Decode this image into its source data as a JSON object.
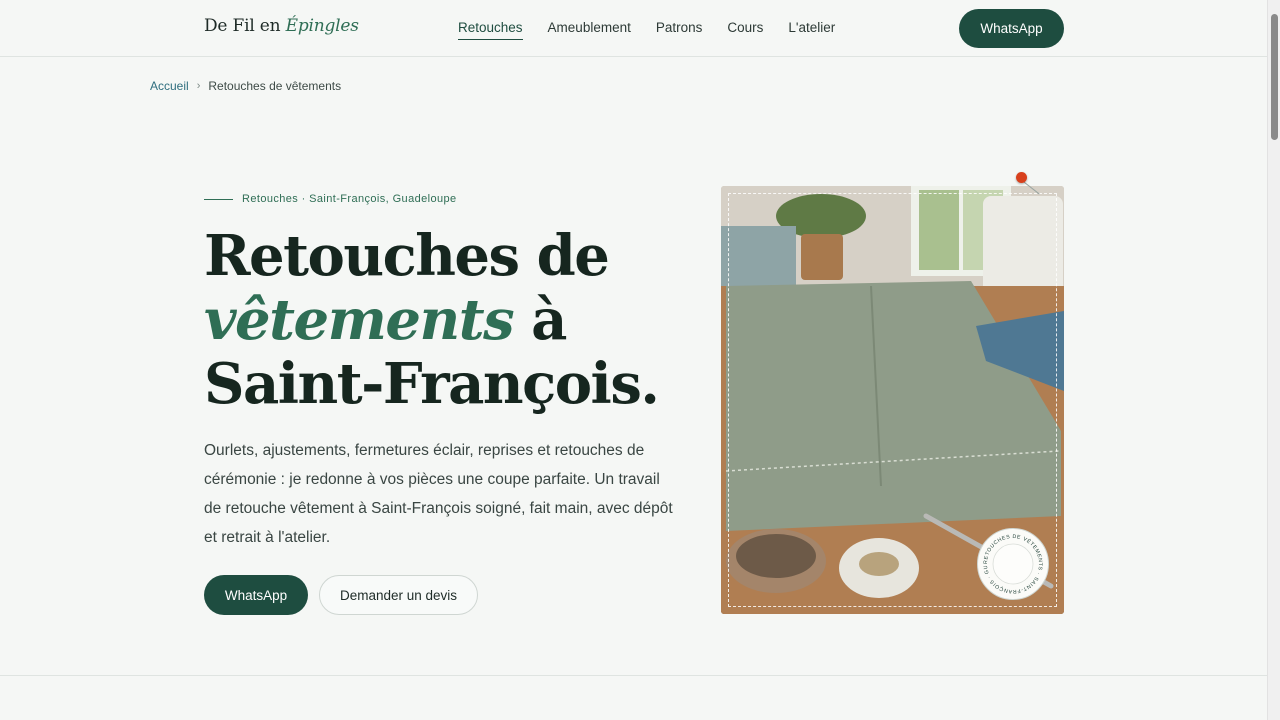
{
  "header": {
    "logo_main": "De Fil en",
    "logo_accent": "Épingles",
    "nav": [
      {
        "label": "Retouches"
      },
      {
        "label": "Ameublement"
      },
      {
        "label": "Patrons"
      },
      {
        "label": "Cours"
      },
      {
        "label": "L'atelier"
      }
    ],
    "cta_label": "WhatsApp"
  },
  "breadcrumb": {
    "home": "Accueil",
    "separator": "›",
    "current": "Retouches de vêtements"
  },
  "hero": {
    "eyebrow": "Retouches · Saint-François, Guadeloupe",
    "title_line1": "Retouches de",
    "title_accent": "vêtements",
    "title_after_accent": " à",
    "title_line3": "Saint-François.",
    "lead": "Ourlets, ajustements, fermetures éclair, reprises et retouches de cérémonie : je redonne à vos pièces une coupe parfaite. Un travail de retouche vêtement à Saint-François soigné, fait main, avec dépôt et retrait à l'atelier.",
    "primary_label": "WhatsApp",
    "secondary_label": "Demander un devis",
    "badge_text": "RETOUCHES DE VÊTEMENTS · SAINT-FRANÇOIS · GUADELOUPE"
  },
  "colors": {
    "accent": "#2f6e55",
    "button": "#1e4d40",
    "background": "#f5f7f5"
  }
}
